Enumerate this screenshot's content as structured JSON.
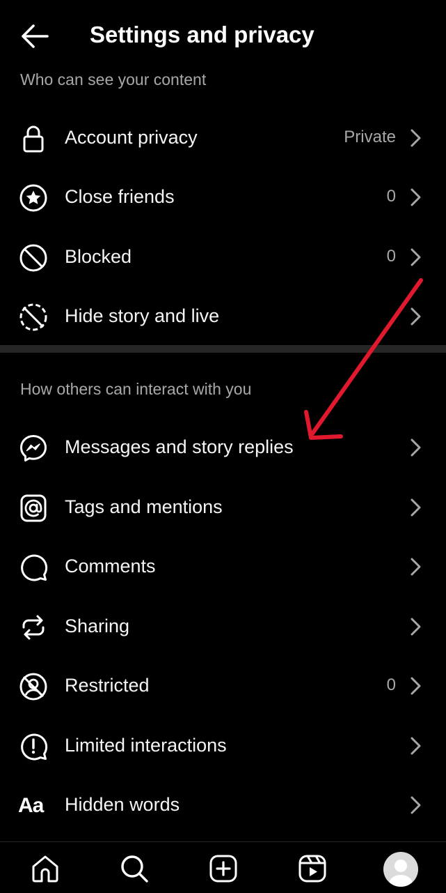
{
  "header": {
    "title": "Settings and privacy",
    "back_icon": "arrow-left-icon"
  },
  "sections": [
    {
      "title": "Who can see your content",
      "items": [
        {
          "label": "Account privacy",
          "value": "Private",
          "icon": "lock-icon"
        },
        {
          "label": "Close friends",
          "value": "0",
          "icon": "star-circle-icon"
        },
        {
          "label": "Blocked",
          "value": "0",
          "icon": "blocked-icon"
        },
        {
          "label": "Hide story and live",
          "value": "",
          "icon": "hide-story-icon"
        }
      ]
    },
    {
      "title": "How others can interact with you",
      "items": [
        {
          "label": "Messages and story replies",
          "value": "",
          "icon": "messenger-icon"
        },
        {
          "label": "Tags and mentions",
          "value": "",
          "icon": "at-sign-icon"
        },
        {
          "label": "Comments",
          "value": "",
          "icon": "comment-icon"
        },
        {
          "label": "Sharing",
          "value": "",
          "icon": "sharing-icon"
        },
        {
          "label": "Restricted",
          "value": "0",
          "icon": "restricted-icon"
        },
        {
          "label": "Limited interactions",
          "value": "",
          "icon": "limited-interactions-icon"
        },
        {
          "label": "Hidden words",
          "value": "",
          "icon": "hidden-words-icon",
          "icon_text": "Aa"
        }
      ]
    }
  ],
  "bottom_nav": [
    {
      "icon": "home-icon"
    },
    {
      "icon": "search-icon"
    },
    {
      "icon": "create-icon"
    },
    {
      "icon": "reels-icon"
    },
    {
      "icon": "profile-avatar-icon"
    }
  ],
  "colors": {
    "background": "#000000",
    "text_primary": "#f5f5f5",
    "text_secondary": "#a8a8a8",
    "divider": "#262626",
    "annotation_arrow": "#e0192e"
  }
}
